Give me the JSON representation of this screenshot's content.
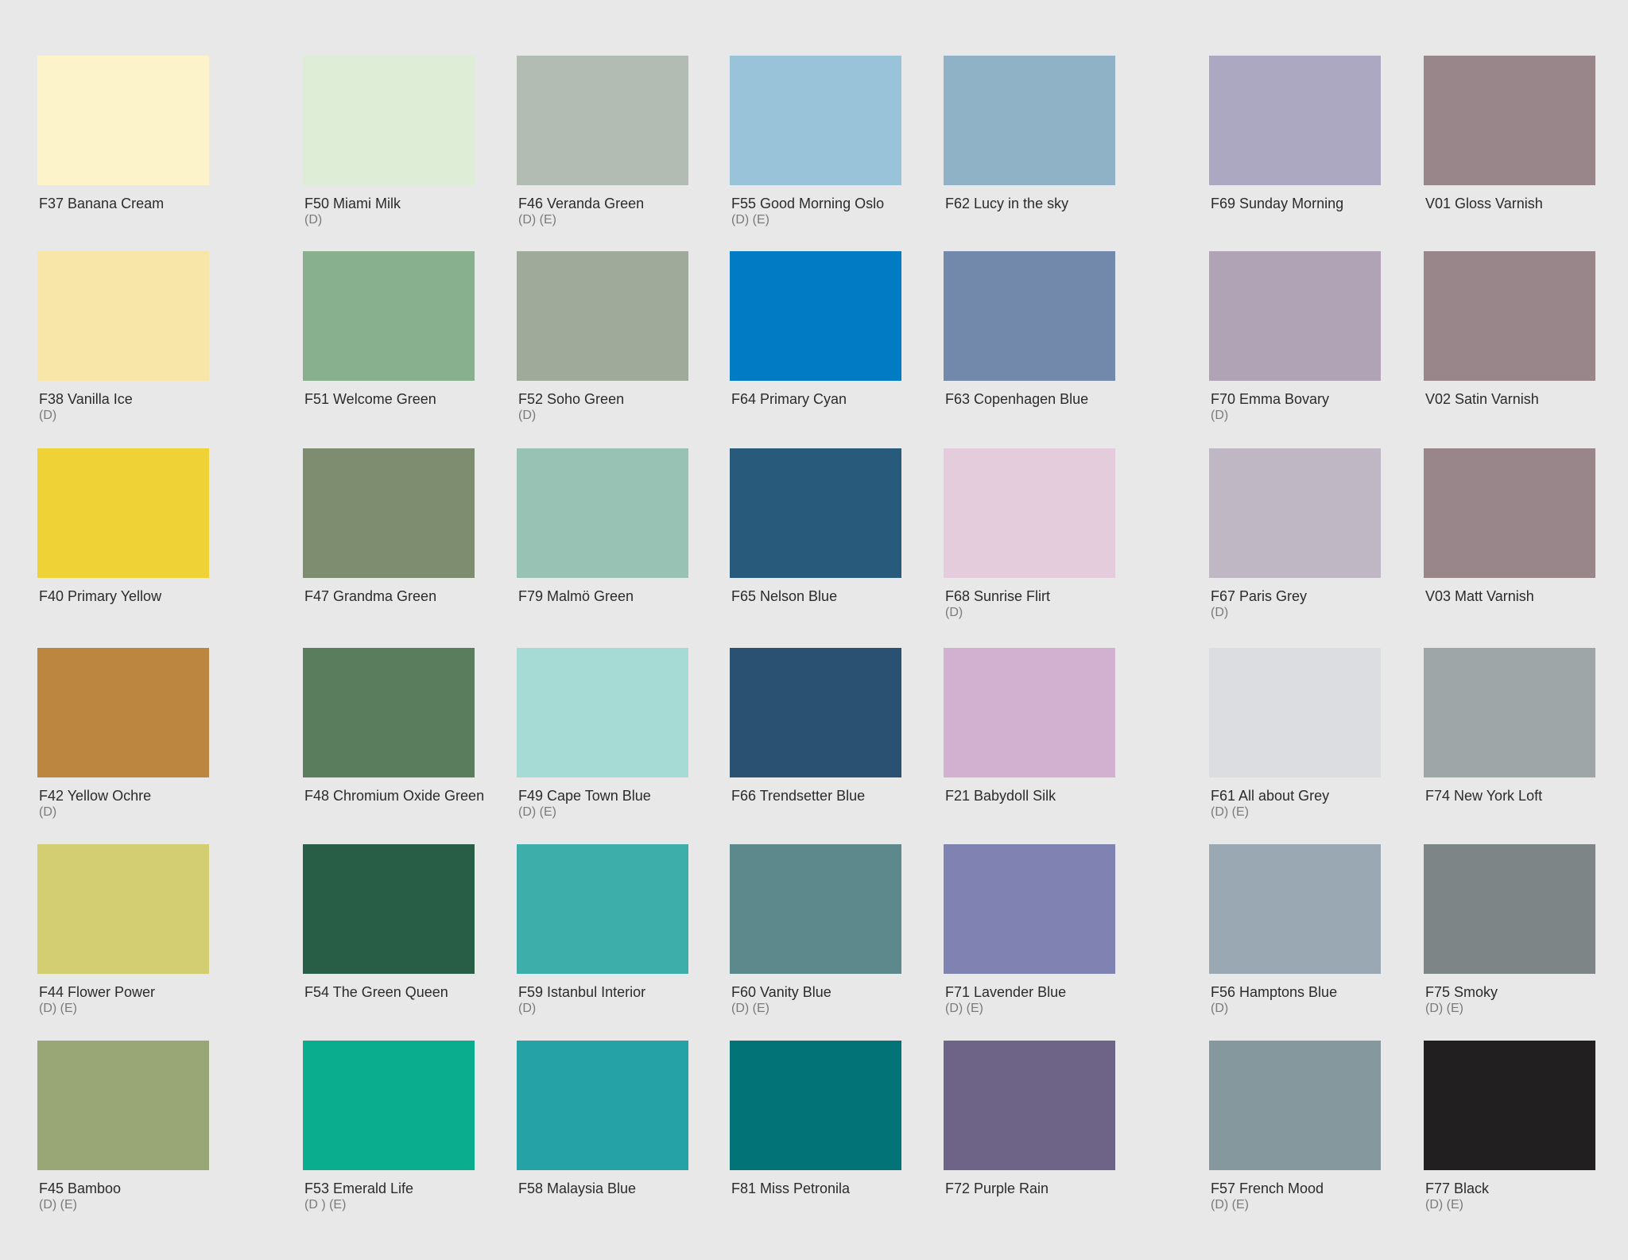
{
  "swatches": [
    {
      "name": "F37 Banana Cream",
      "note": "",
      "color": "#fdf3cb"
    },
    {
      "name": "F50 Miami Milk",
      "note": "(D)",
      "color": "#deedd6"
    },
    {
      "name": "F46 Veranda Green",
      "note": "(D) (E)",
      "color": "#b3bcb3"
    },
    {
      "name": "F55 Good Morning Oslo",
      "note": "(D) (E)",
      "color": "#98c3d8"
    },
    {
      "name": "F62 Lucy in the sky",
      "note": "",
      "color": "#8fb2c6"
    },
    {
      "name": "F69 Sunday Morning",
      "note": "",
      "color": "#aca8c2"
    },
    {
      "name": "V01 Gloss Varnish",
      "note": "",
      "color": "#98868a"
    },
    {
      "name": "F38 Vanilla Ice",
      "note": "(D)",
      "color": "#f7e6a8"
    },
    {
      "name": "F51 Welcome Green",
      "note": "",
      "color": "#88b08e"
    },
    {
      "name": "F52 Soho Green",
      "note": "(D)",
      "color": "#9faa9b"
    },
    {
      "name": "F64 Primary Cyan",
      "note": "",
      "color": "#007bc4"
    },
    {
      "name": "F63 Copenhagen Blue",
      "note": "",
      "color": "#7389ab"
    },
    {
      "name": "F70 Emma Bovary",
      "note": "(D)",
      "color": "#afa3b5"
    },
    {
      "name": "V02 Satin Varnish",
      "note": "",
      "color": "#98868a"
    },
    {
      "name": "F40 Primary Yellow",
      "note": "",
      "color": "#efd336"
    },
    {
      "name": "F47 Grandma Green",
      "note": "",
      "color": "#7e8c70"
    },
    {
      "name": "F79 Malmö Green",
      "note": "",
      "color": "#98c3b4"
    },
    {
      "name": "F65 Nelson Blue",
      "note": "",
      "color": "#275a7b"
    },
    {
      "name": "F68 Sunrise Flirt",
      "note": "(D)",
      "color": "#e4ccdd"
    },
    {
      "name": "F67 Paris Grey",
      "note": "(D)",
      "color": "#bfb7c4"
    },
    {
      "name": "V03 Matt Varnish",
      "note": "",
      "color": "#98868a"
    },
    {
      "name": "F42 Yellow Ochre",
      "note": "(D)",
      "color": "#bc8640"
    },
    {
      "name": "F48 Chromium Oxide Green",
      "note": "",
      "color": "#5a7d5e"
    },
    {
      "name": "F49 Cape Town Blue",
      "note": "(D) (E)",
      "color": "#a6dbd5"
    },
    {
      "name": "F66 Trendsetter Blue",
      "note": "",
      "color": "#2a5072"
    },
    {
      "name": "F21 Babydoll Silk",
      "note": "",
      "color": "#d2b0cf"
    },
    {
      "name": "F61 All about Grey",
      "note": "(D) (E)",
      "color": "#dbdde1"
    },
    {
      "name": "F74 New York Loft",
      "note": "",
      "color": "#9fa6a8"
    },
    {
      "name": "F44 Flower Power",
      "note": "(D) (E)",
      "color": "#d3ce72"
    },
    {
      "name": "F54 The Green Queen",
      "note": "",
      "color": "#275e45"
    },
    {
      "name": "F59 Istanbul Interior",
      "note": "(D)",
      "color": "#3daeaa"
    },
    {
      "name": "F60 Vanity Blue",
      "note": "(D) (E)",
      "color": "#5d888c"
    },
    {
      "name": "F71 Lavender Blue",
      "note": "(D) (E)",
      "color": "#8083b1"
    },
    {
      "name": "F56 Hamptons Blue",
      "note": "(D)",
      "color": "#9aa8b4"
    },
    {
      "name": "F75 Smoky",
      "note": "(D) (E)",
      "color": "#7e8586"
    },
    {
      "name": "F45 Bamboo",
      "note": "(D) (E)",
      "color": "#98a775"
    },
    {
      "name": "F53 Emerald Life",
      "note": "(D ) (E)",
      "color": "#0aad8d"
    },
    {
      "name": "F58 Malaysia Blue",
      "note": "",
      "color": "#25a2a5"
    },
    {
      "name": "F81 Miss Petronila",
      "note": "",
      "color": "#027376"
    },
    {
      "name": "F72 Purple Rain",
      "note": "",
      "color": "#6d6487"
    },
    {
      "name": "F57 French Mood",
      "note": "(D) (E)",
      "color": "#85989d"
    },
    {
      "name": "F77 Black",
      "note": "(D) (E)",
      "color": "#221f20"
    }
  ]
}
